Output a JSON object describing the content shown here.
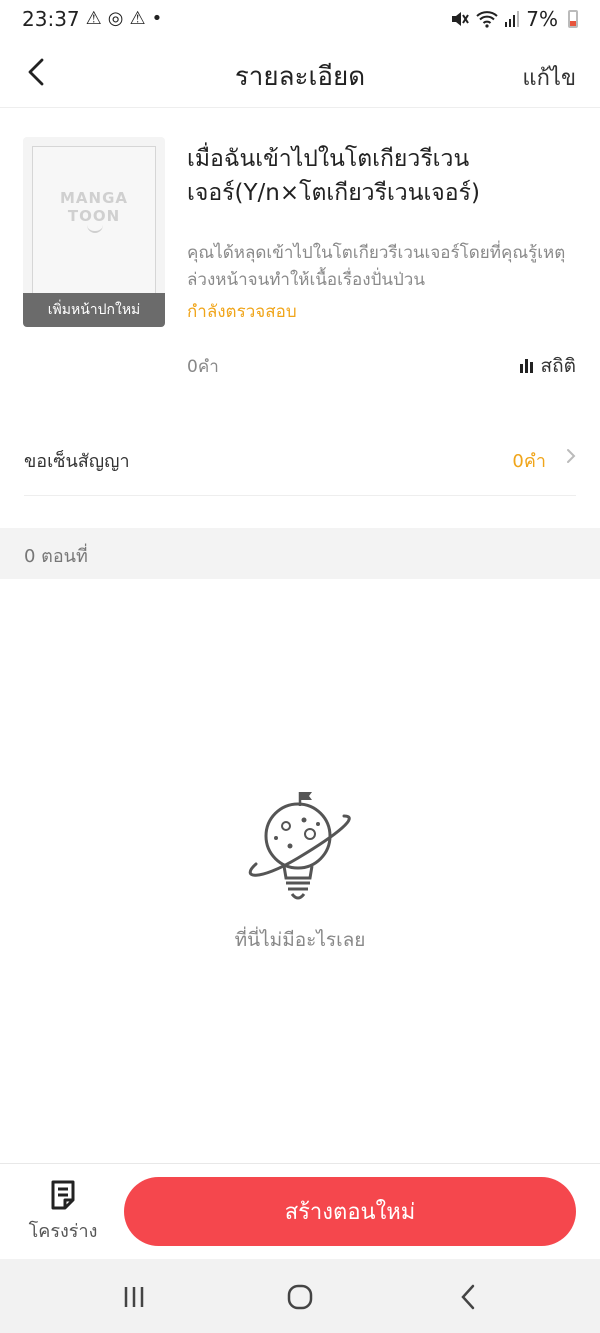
{
  "status_bar": {
    "time": "23:37",
    "battery": "7%"
  },
  "header": {
    "title": "รายละเอียด",
    "edit_label": "แก้ไข"
  },
  "book": {
    "cover_logo_line1": "MANGA",
    "cover_logo_line2": "TOON",
    "cover_add_label": "เพิ่มหน้าปกใหม่",
    "title": "เมื่อฉันเข้าไปในโตเกียวรีเวนเจอร์(Y/n×โตเกียวรีเวนเจอร์)",
    "description": "คุณได้หลุดเข้าไปในโตเกียวรีเวนเจอร์โดยที่คุณรู้เหตุล่วงหน้าจนทำให้เนื้อเรื่องปั่นป่วน",
    "status": "กำลังตรวจสอบ",
    "word_count": "0คำ",
    "stats_label": "สถิติ"
  },
  "contract": {
    "label": "ขอเซ็นสัญญา",
    "value": "0คำ"
  },
  "episodes": {
    "count_label": "0 ตอนที่"
  },
  "empty_state": {
    "text": "ที่นี่ไม่มีอะไรเลย"
  },
  "bottom_bar": {
    "draft_label": "โครงร่าง",
    "create_label": "สร้างตอนใหม่"
  },
  "colors": {
    "accent_orange": "#f0a51a",
    "primary_red": "#f5474d"
  }
}
